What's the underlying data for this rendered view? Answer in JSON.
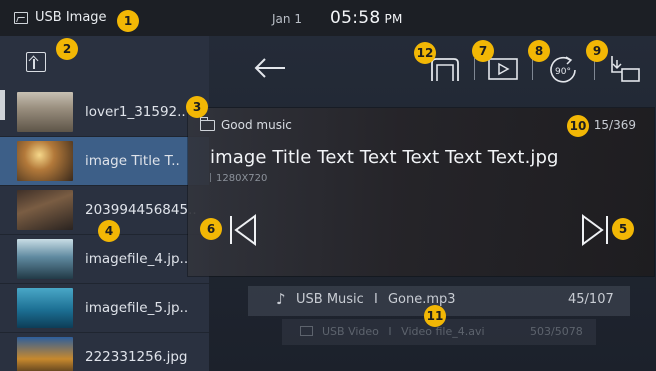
{
  "topbar": {
    "source_label": "USB Image",
    "date": "Jan 1",
    "time": "05:58",
    "ampm": "PM"
  },
  "sidebar": {
    "items": [
      {
        "label": "lover1_31592..",
        "thumb": "t1",
        "selected": false
      },
      {
        "label": "image Title T..",
        "thumb": "t2",
        "selected": true
      },
      {
        "label": "203994456845..",
        "thumb": "t3",
        "selected": false
      },
      {
        "label": "imagefile_4.jp..",
        "thumb": "t4",
        "selected": false
      },
      {
        "label": "imagefile_5.jp..",
        "thumb": "t5",
        "selected": false
      },
      {
        "label": "222331256.jpg",
        "thumb": "t6",
        "selected": false
      }
    ]
  },
  "toolbar": {
    "icons": [
      "back-arrow-icon",
      "stop-slideshow-icon",
      "play-slideshow-icon",
      "rotate-90-icon",
      "save-to-device-icon"
    ],
    "rotate_label": "90°"
  },
  "panel": {
    "folder": "Good music",
    "count": "15/369",
    "title": "image Title Text Text Text Text Text.jpg",
    "resolution": "1280X720"
  },
  "music": {
    "source": "USB Music",
    "separator": "I",
    "file": "Gone.mp3",
    "count": "45/107"
  },
  "video": {
    "source": "USB Video",
    "separator": "I",
    "file": "Video file_4.avi",
    "count": "503/5078"
  },
  "badges": {
    "b1": "1",
    "b2": "2",
    "b3": "3",
    "b4": "4",
    "b5": "5",
    "b6": "6",
    "b7": "7",
    "b8": "8",
    "b9": "9",
    "b10": "10",
    "b11": "11",
    "b12": "12"
  },
  "colors": {
    "accent_badge": "#f2b705",
    "selected_row": "#3d5f88",
    "sidebar_bg": "#2a3140"
  }
}
